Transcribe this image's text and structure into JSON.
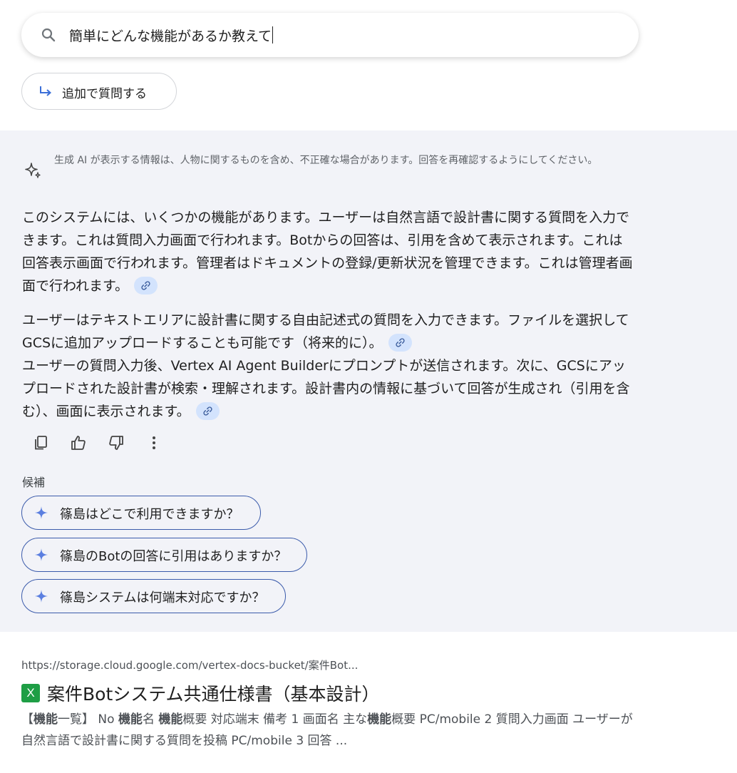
{
  "search": {
    "query": "簡単にどんな機能があるか教えて",
    "icon": "search-icon"
  },
  "followup": {
    "label": "追加で質問する",
    "icon": "subdirectory-arrow-icon"
  },
  "ai_overview": {
    "disclaimer": "生成 AI が表示する情報は、人物に関するものを含め、不正確な場合があります。回答を再確認するようにしてください。",
    "paragraphs": [
      "このシステムには、いくつかの機能があります。ユーザーは自然言語で設計書に関する質問を入力できます。これは質問入力画面で行われます。Botからの回答は、引用を含めて表示されます。これは回答表示画面で行われます。管理者はドキュメントの登録/更新状況を管理できます。これは管理者画面で行われます。",
      "ユーザーはテキストエリアに設計書に関する自由記述式の質問を入力できます。ファイルを選択してGCSに追加アップロードすることも可能です（将来的に）。",
      "ユーザーの質問入力後、Vertex AI Agent Builderにプロンプトが送信されます。次に、GCSにアップロードされた設計書が検索・理解されます。設計書内の情報に基づいて回答が生成され（引用を含む）、画面に表示されます。"
    ],
    "actions": [
      "copy-icon",
      "thumbs-up-icon",
      "thumbs-down-icon",
      "more-vert-icon"
    ],
    "suggestions_title": "候補",
    "suggestions": [
      "篠島はどこで利用できますか？",
      "篠島のBotの回答に引用はありますか？",
      "篠島システムは何端末対応ですか？"
    ]
  },
  "result": {
    "url": "https://storage.cloud.google.com/vertex-docs-bucket/案件Bot...",
    "icon_letter": "X",
    "title": "案件Botシステム共通仕様書（基本設計）",
    "snippet_html_parts": {
      "p1": "【",
      "b1": "機能",
      "p2": "一覧】 No ",
      "b2": "機能",
      "p3": "名 ",
      "b3": "機能",
      "p4": "概要 対応端末 備考 1 画面名 主な",
      "b4": "機能",
      "p5": "概要 PC/mobile 2 質問入力画面 ユーザーが自然言語で設計書に関する質問を投稿 PC/mobile 3 回答 ..."
    }
  },
  "colors": {
    "panel_bg": "#f2f3f8",
    "chip_bg": "#d3e3fd",
    "accent": "#3b5bab",
    "excel_green": "#1e9e45"
  }
}
